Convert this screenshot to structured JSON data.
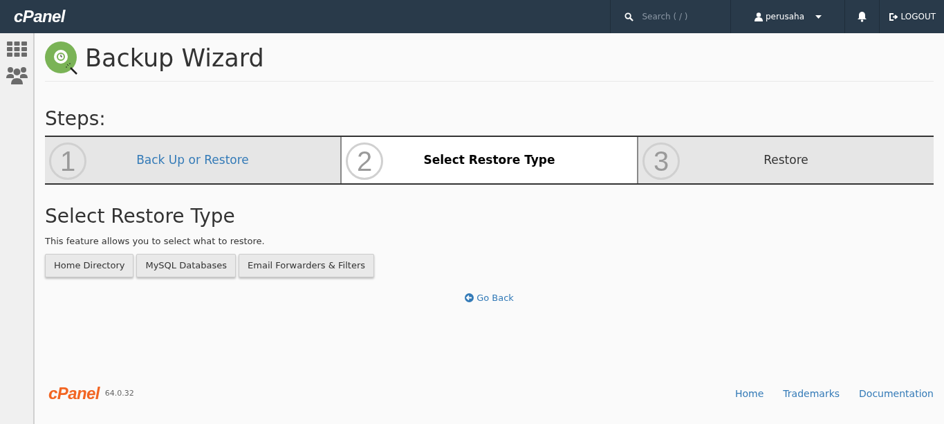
{
  "topbar": {
    "logo": "cPanel",
    "search": {
      "placeholder": "Search ( / )"
    },
    "user": "perusaha",
    "logout": "LOGOUT"
  },
  "page": {
    "title": "Backup Wizard",
    "steps_heading": "Steps:",
    "steps": [
      {
        "number": "1",
        "label": "Back Up or Restore",
        "kind": "link",
        "selected": false
      },
      {
        "number": "2",
        "label": "Select Restore Type",
        "kind": "current",
        "selected": true
      },
      {
        "number": "3",
        "label": "Restore",
        "kind": "pending",
        "selected": false
      }
    ],
    "section_title": "Select Restore Type",
    "description": "This feature allows you to select what to restore.",
    "buttons": [
      "Home Directory",
      "MySQL Databases",
      "Email Forwarders & Filters"
    ],
    "go_back": "Go Back"
  },
  "footer": {
    "logo": "cPanel",
    "version": "64.0.32",
    "links": [
      "Home",
      "Trademarks",
      "Documentation"
    ]
  }
}
